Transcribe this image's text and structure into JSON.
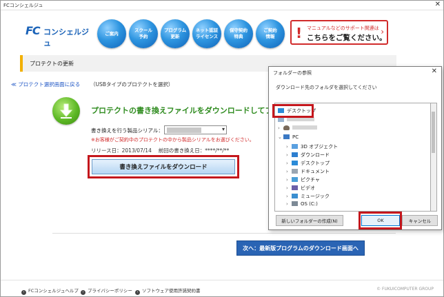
{
  "window": {
    "title": "FCコンシェルジュ",
    "close": "✕"
  },
  "header": {
    "logo_mark": "FC",
    "logo_name": "コンシェルジュ",
    "nav": [
      "ご案内",
      "スクール\n予約",
      "プログラム\n更新",
      "ネット認証\nライセンス",
      "保守契約\n特典",
      "ご契約\n情報"
    ],
    "support_line1": "マニュアルなどのサポート関連は",
    "support_line2": "こちらをご覧ください。",
    "support_bang": "!",
    "support_chevron": "›"
  },
  "section_title": "プロテクトの更新",
  "back_link": "≪ プロテクト選択画面に戻る",
  "back_note": "（USBタイプのプロテクトを選択）",
  "main": {
    "heading": "プロテクトの書き換えファイルをダウンロードしてプロテクト",
    "serial_label": "書き換えを行う製品シリアル：",
    "warning": "※お客様がご契約中のプロテクトの中から製品シリアルをお選びください。",
    "release_date": "リリース日：2013/07/14　 前回の書き換え日：****/**/**",
    "download_button": "書き換えファイルをダウンロード",
    "next_button": "次へ：最新版プログラムのダウンロード画面へ"
  },
  "footer": {
    "items": [
      "FCコンシェルジュヘルプ",
      "プライバシーポリシー",
      "ソフトウェア使用許諾契約書"
    ],
    "copyright": "© FUKUICOMPUTER GROUP"
  },
  "dialog": {
    "title": "フォルダーの参照",
    "close": "✕",
    "instruction": "ダウンロード先のフォルダを選択してください",
    "tree": [
      {
        "label": "デスクトップ",
        "icon": "desktop-icon"
      },
      {
        "label": "PC",
        "icon": "pc-icon"
      },
      {
        "label": "3D オブジェクト",
        "icon": "3d-objects-icon"
      },
      {
        "label": "ダウンロード",
        "icon": "download-folder-icon"
      },
      {
        "label": "デスクトップ",
        "icon": "desktop-icon"
      },
      {
        "label": "ドキュメント",
        "icon": "documents-icon"
      },
      {
        "label": "ピクチャ",
        "icon": "pictures-icon"
      },
      {
        "label": "ビデオ",
        "icon": "videos-icon"
      },
      {
        "label": "ミュージック",
        "icon": "music-icon"
      },
      {
        "label": "OS (C:)",
        "icon": "drive-icon"
      }
    ],
    "new_folder_button": "新しいフォルダーの作成(N)",
    "ok_button": "OK",
    "cancel_button": "キャンセル"
  },
  "colors": {
    "highlight": "#c4161c",
    "brand": "#1b63b8",
    "heading_green": "#2e8b1e"
  }
}
